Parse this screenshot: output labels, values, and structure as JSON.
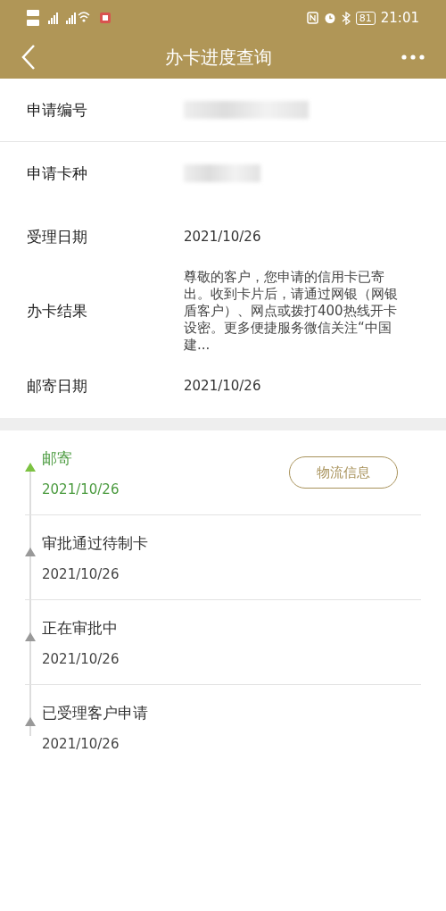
{
  "status_bar": {
    "battery": "81",
    "time": "21:01"
  },
  "nav": {
    "title": "办卡进度查询"
  },
  "details": [
    {
      "label": "申请编号",
      "kind": "redacted"
    },
    {
      "label": "申请卡种",
      "kind": "redacted"
    },
    {
      "label": "受理日期",
      "kind": "text",
      "value": "2021/10/26"
    },
    {
      "label": "办卡结果",
      "kind": "paragraph",
      "value": "尊敬的客户，您申请的信用卡已寄出。收到卡片后，请通过网银（网银盾客户）、网点或拨打400热线开卡设密。更多便捷服务微信关注“中国建..."
    },
    {
      "label": "邮寄日期",
      "kind": "text",
      "value": "2021/10/26"
    }
  ],
  "timeline": [
    {
      "title": "邮寄",
      "date": "2021/10/26",
      "selected": true,
      "action": "物流信息"
    },
    {
      "title": "审批通过待制卡",
      "date": "2021/10/26",
      "selected": false
    },
    {
      "title": "正在审批中",
      "date": "2021/10/26",
      "selected": false
    },
    {
      "title": "已受理客户申请",
      "date": "2021/10/26",
      "selected": false
    }
  ]
}
